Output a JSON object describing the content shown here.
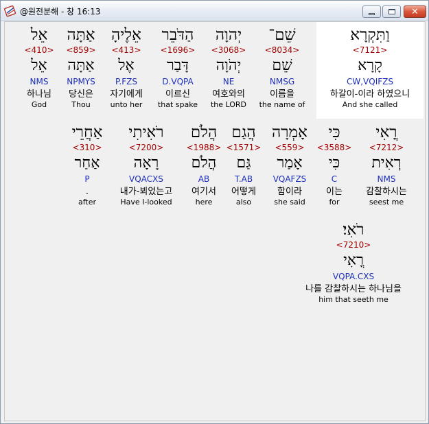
{
  "window": {
    "title": "@원전분해 - 창 16:13",
    "icon": "app-book-icon",
    "controls": [
      "minimize-icon",
      "maximize-icon",
      "close-icon"
    ],
    "close_glyph": "✕"
  },
  "rows": [
    [
      {
        "hebrew": "אֵל",
        "strong": "<410>",
        "lemma": "אֵל",
        "morph": "NMS",
        "korean": "하나님",
        "english": "God"
      },
      {
        "hebrew": "אַתָּה",
        "strong": "<859>",
        "lemma": "אַתָּה",
        "morph": "NPMYS",
        "korean": "당신은",
        "english": "Thou"
      },
      {
        "hebrew": "אֵלֶיהָ",
        "strong": "<413>",
        "lemma": "אֶל",
        "morph": "P.FZS",
        "korean": "자기에게",
        "english": "unto her"
      },
      {
        "hebrew": "הַדֹּבֵר",
        "strong": "<1696>",
        "lemma": "דָּבַר",
        "morph": "D.VQPA",
        "korean": "이르신",
        "english": "that spake"
      },
      {
        "hebrew": "יְהוָה",
        "strong": "<3068>",
        "lemma": "יְהֹוָה",
        "morph": "NE",
        "korean": "여호와의",
        "english": "the LORD"
      },
      {
        "hebrew": "שֵׁם־",
        "strong": "<8034>",
        "lemma": "שֵׁם",
        "morph": "NMSG",
        "korean": "이름을",
        "english": "the name of"
      },
      {
        "hebrew": "וַתִּקְרָא",
        "strong": "<7121>",
        "lemma": "קָרָא",
        "morph": "CW,VQIFZS",
        "korean": "하갈이-이라 하였으니",
        "english": "And she called"
      }
    ],
    [
      {
        "hebrew": "אַחֲרֵי",
        "strong": "<310>",
        "lemma": "אַחַר",
        "morph": "P",
        "korean": ".",
        "english": "after"
      },
      {
        "hebrew": "רֹאִיתִי",
        "strong": "<7200>",
        "lemma": "רָאָה",
        "morph": "VQACXS",
        "korean": "내가-뵈었는고",
        "english": "Have I-looked"
      },
      {
        "hebrew": "הֲלֹם",
        "strong": "<1988>",
        "lemma": "הֲלֹם",
        "morph": "AB",
        "korean": "여기서",
        "english": "here"
      },
      {
        "hebrew": "הֲגַם",
        "strong": "<1571>",
        "lemma": "גַּם",
        "morph": "T.AB",
        "korean": "어떻게",
        "english": "also"
      },
      {
        "hebrew": "אָמְרָה",
        "strong": "<559>",
        "lemma": "אָמַר",
        "morph": "VQAFZS",
        "korean": "함이라",
        "english": "she said"
      },
      {
        "hebrew": "כִּי",
        "strong": "<3588>",
        "lemma": "כִּי",
        "morph": "C",
        "korean": "이는",
        "english": "for"
      },
      {
        "hebrew": "רֳאִי",
        "strong": "<7212>",
        "lemma": "רְאִית",
        "morph": "NMS",
        "korean": "감찰하시는",
        "english": "seest me"
      }
    ],
    [
      {
        "hebrew": "רֹאִי׃",
        "strong": "<7210>",
        "lemma": "רֳאִי",
        "morph": "VQPA.CXS",
        "korean": "나를 감찰하시는 하나님을",
        "english": "him that seeth me"
      }
    ]
  ]
}
